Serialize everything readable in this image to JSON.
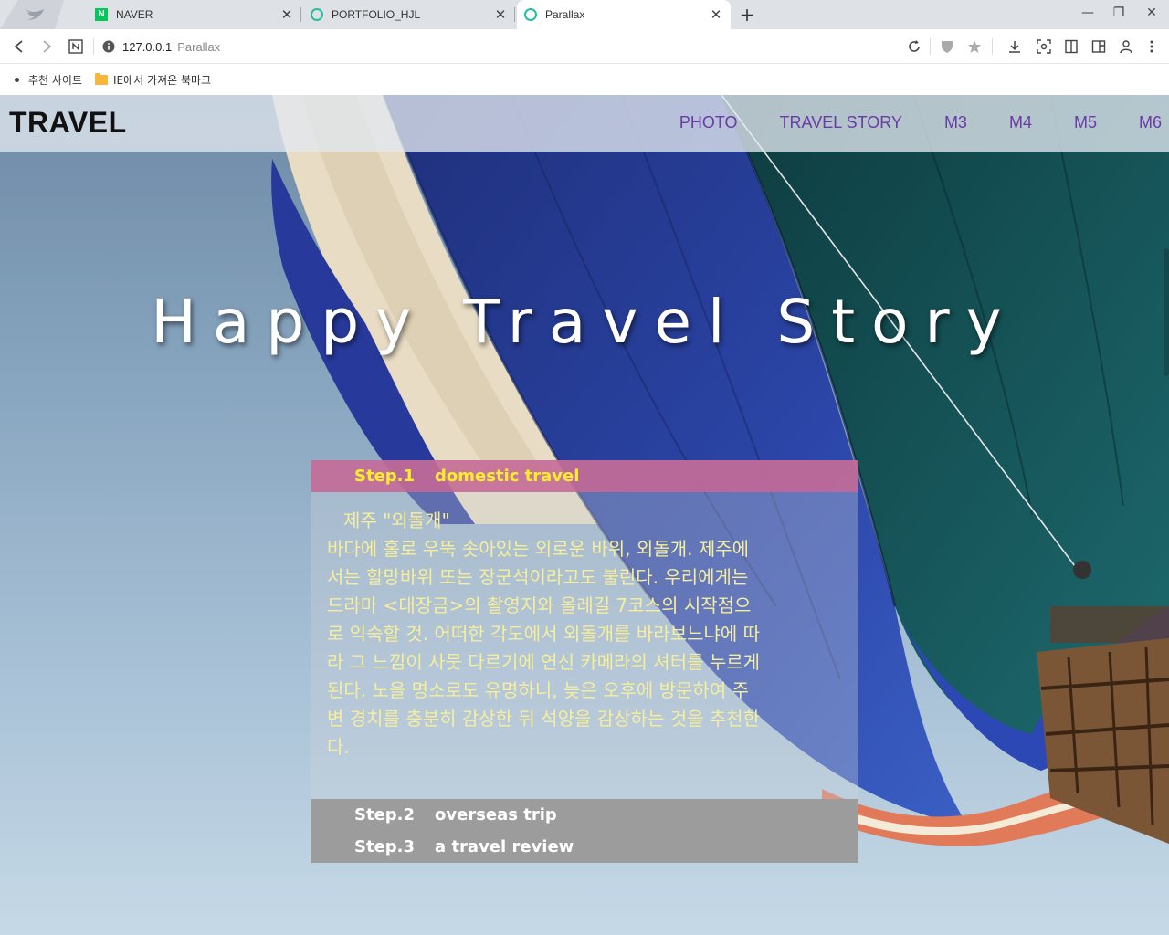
{
  "browser": {
    "tabs": [
      {
        "title": "NAVER",
        "favicon": "naver-icon",
        "active": false
      },
      {
        "title": "PORTFOLIO_HJL",
        "favicon": "ring-icon",
        "active": false
      },
      {
        "title": "Parallax",
        "favicon": "ring-icon",
        "active": true
      }
    ],
    "address": {
      "host": "127.0.0.1",
      "title": "Parallax"
    },
    "bookmarks": [
      {
        "label": "추천 사이트",
        "icon": "dot-icon"
      },
      {
        "label": "IE에서 가져온 북마크",
        "icon": "folder-icon"
      }
    ]
  },
  "site": {
    "logo": "TRAVEL",
    "nav": [
      "PHOTO",
      "TRAVEL STORY",
      "M3",
      "M4",
      "M5",
      "M6"
    ],
    "hero_title": "Happy Travel Story",
    "steps": [
      {
        "num": "Step.1",
        "title": "domestic travel"
      },
      {
        "num": "Step.2",
        "title": "overseas trip"
      },
      {
        "num": "Step.3",
        "title": "a travel review"
      }
    ],
    "step1_subtitle": "제주 \"외돌개\"",
    "step1_lines": [
      "바다에 홀로 우뚝 솟아있는 외로운 바위, 외돌개. 제주에",
      "서는 할망바위 또는 장군석이라고도 불린다. 우리에게는",
      "드라마 <대장금>의 촬영지와 올레길 7코스의 시작점으",
      "로 익숙할 것. 어떠한 각도에서 외돌개를 바라보느냐에 따",
      "라 그 느낌이 사뭇 다르기에 연신 카메라의 셔터를 누르게",
      "된다. 노을 명소로도 유명하니, 늦은 오후에 방문하여 주",
      "변 경치를 충분히 감상한 뒤 석양을 감상하는 것을 추천한",
      "다."
    ]
  },
  "colors": {
    "nav": "#6a3aa7",
    "step1_bg": "#c46c98",
    "step1_text": "#ffef2a",
    "body_text": "#f6ee9c",
    "step_rest_bg": "#9c9c9c"
  }
}
